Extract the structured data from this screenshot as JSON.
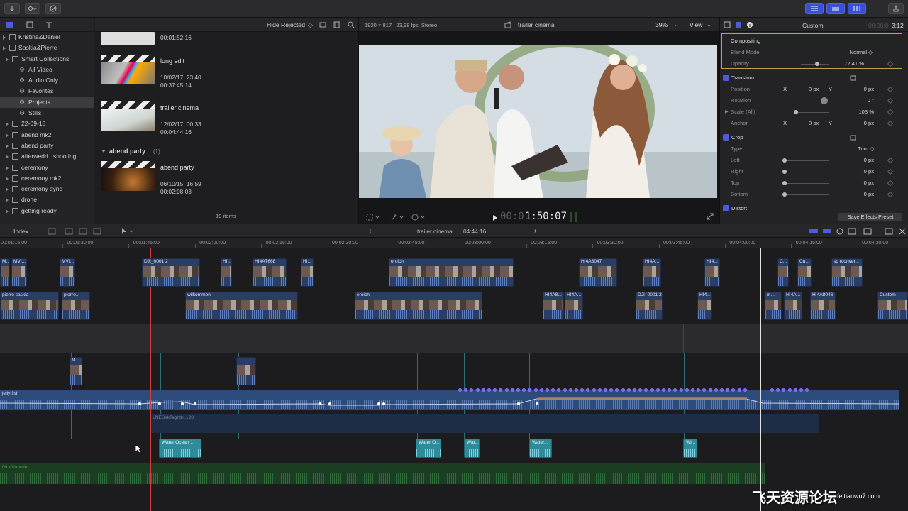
{
  "library": {
    "items": [
      {
        "label": "Kristina&Daniel",
        "indent": 1,
        "tri": true
      },
      {
        "label": "Saskia&Pierre",
        "indent": 1,
        "tri": true
      },
      {
        "label": "Smart Collections",
        "indent": 2,
        "tri": true
      },
      {
        "label": "All Video",
        "indent": 3
      },
      {
        "label": "Audio Only",
        "indent": 3
      },
      {
        "label": "Favorites",
        "indent": 3
      },
      {
        "label": "Projects",
        "indent": 3,
        "sel": true
      },
      {
        "label": "Stills",
        "indent": 3
      },
      {
        "label": "22-09-15",
        "indent": 2,
        "tri": true
      },
      {
        "label": "abend mk2",
        "indent": 2,
        "tri": true
      },
      {
        "label": "abend party",
        "indent": 2,
        "tri": true
      },
      {
        "label": "afterwedd...shooting",
        "indent": 2,
        "tri": true
      },
      {
        "label": "ceremony",
        "indent": 2,
        "tri": true
      },
      {
        "label": "ceremony mk2",
        "indent": 2,
        "tri": true
      },
      {
        "label": "ceremony sync",
        "indent": 2,
        "tri": true
      },
      {
        "label": "drone",
        "indent": 2,
        "tri": true
      },
      {
        "label": "getting ready",
        "indent": 2,
        "tri": true
      }
    ]
  },
  "browser": {
    "filter": "Hide Rejected",
    "footer": "19 items",
    "top_duration": "00:01:52:16",
    "clips": [
      {
        "name": "long edit",
        "date": "10/02/17, 23:40",
        "duration": "00:37:45:14"
      },
      {
        "name": "trailer cinema",
        "date": "12/02/17, 00:33",
        "duration": "00:04:44:16"
      },
      {
        "name": "abend party",
        "date": "06/10/15, 16:59",
        "duration": "00:02:08:03"
      }
    ],
    "group_label": "abend party",
    "group_count": "(1)"
  },
  "viewer": {
    "format": "1920 × 817 | 23,98 fps, Stereo",
    "title": "trailer cinema",
    "zoom": "39%",
    "view_label": "View",
    "timecode": "1:50:07",
    "timecode_prefix": "00:0"
  },
  "inspector": {
    "title": "Custom",
    "duration_dim": "00:00:0",
    "duration": "3:12",
    "compositing": "Compositing",
    "blend_mode_label": "Blend Mode",
    "blend_mode_value": "Normal ◇",
    "opacity_label": "Opacity",
    "opacity_value": "72,41 %",
    "transform": "Transform",
    "position_label": "Position",
    "x": "X",
    "y": "Y",
    "position_x": "0 px",
    "position_y": "0 px",
    "rotation_label": "Rotation",
    "rotation_value": "0 °",
    "scale_label": "Scale (All)",
    "scale_value": "103 %",
    "anchor_label": "Anchor",
    "anchor_x": "0 px",
    "anchor_y": "0 px",
    "crop": "Crop",
    "type_label": "Type",
    "type_value": "Trim ◇",
    "left_label": "Left",
    "right_label": "Right",
    "top_label": "Top",
    "bottom_label": "Bottom",
    "crop_value": "0 px",
    "distort": "Distort",
    "save_preset": "Save Effects Preset"
  },
  "timeline": {
    "index_label": "Index",
    "project_name": "trailer cinema",
    "project_duration": "04:44:16",
    "ruler": [
      "00:01:15:00",
      "00:01:30:00",
      "00:01:45:00",
      "00:02:00:00",
      "00:02:15:00",
      "00:02:30:00",
      "00:02:45:00",
      "00:03:00:00",
      "00:03:15:00",
      "00:03:30:00",
      "00:03:45:00",
      "00:04:00:00",
      "00:04:15:00",
      "00:04:30:00"
    ],
    "upper_clips": [
      "M...",
      "MVI...",
      "MVI...",
      "DJI_0001 2",
      "HI...",
      "HI4A7668",
      "HI...",
      "eroich",
      "HI4A8047",
      "HI4A...",
      "HI4...",
      "C...",
      "Cu...",
      "sp (conver..."
    ],
    "story_clips": [
      "pierre saskia",
      "pierre...",
      "wilkommen",
      "eroich",
      "HI4A8...",
      "HI4A...",
      "DJI_0001 2",
      "HI4...",
      "m...",
      "HI4A...",
      "HI4A8046",
      "Custom"
    ],
    "connected_clips": [
      "M...",
      "..."
    ],
    "music_track": "jelly fish",
    "ambient_track": "LNESskTagnthi.128",
    "water_clips": [
      "Water Ocean 1",
      "Water O...",
      "Wat...",
      "Water...",
      "Wi..."
    ],
    "song_track": "09 Villanelle"
  },
  "watermark": {
    "cn": "飞天资源论坛",
    "url": "feitianwu7.com"
  }
}
